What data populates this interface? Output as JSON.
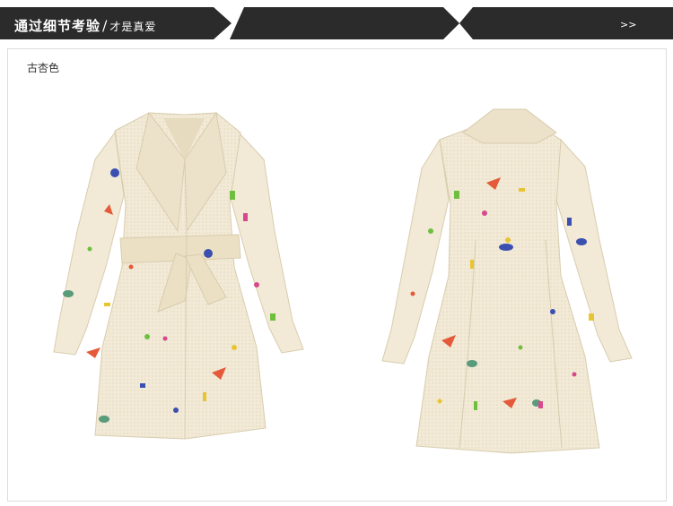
{
  "header": {
    "title": "通过细节考验",
    "separator": "/",
    "subtitle": "才是真爱",
    "more_label": ">>"
  },
  "product": {
    "color_label": "古杏色",
    "views": [
      "front",
      "back"
    ]
  },
  "colors": {
    "header_bg": "#2b2b2b",
    "coat_fabric": "#f2ead6",
    "frame_border": "#dcdcdc"
  }
}
